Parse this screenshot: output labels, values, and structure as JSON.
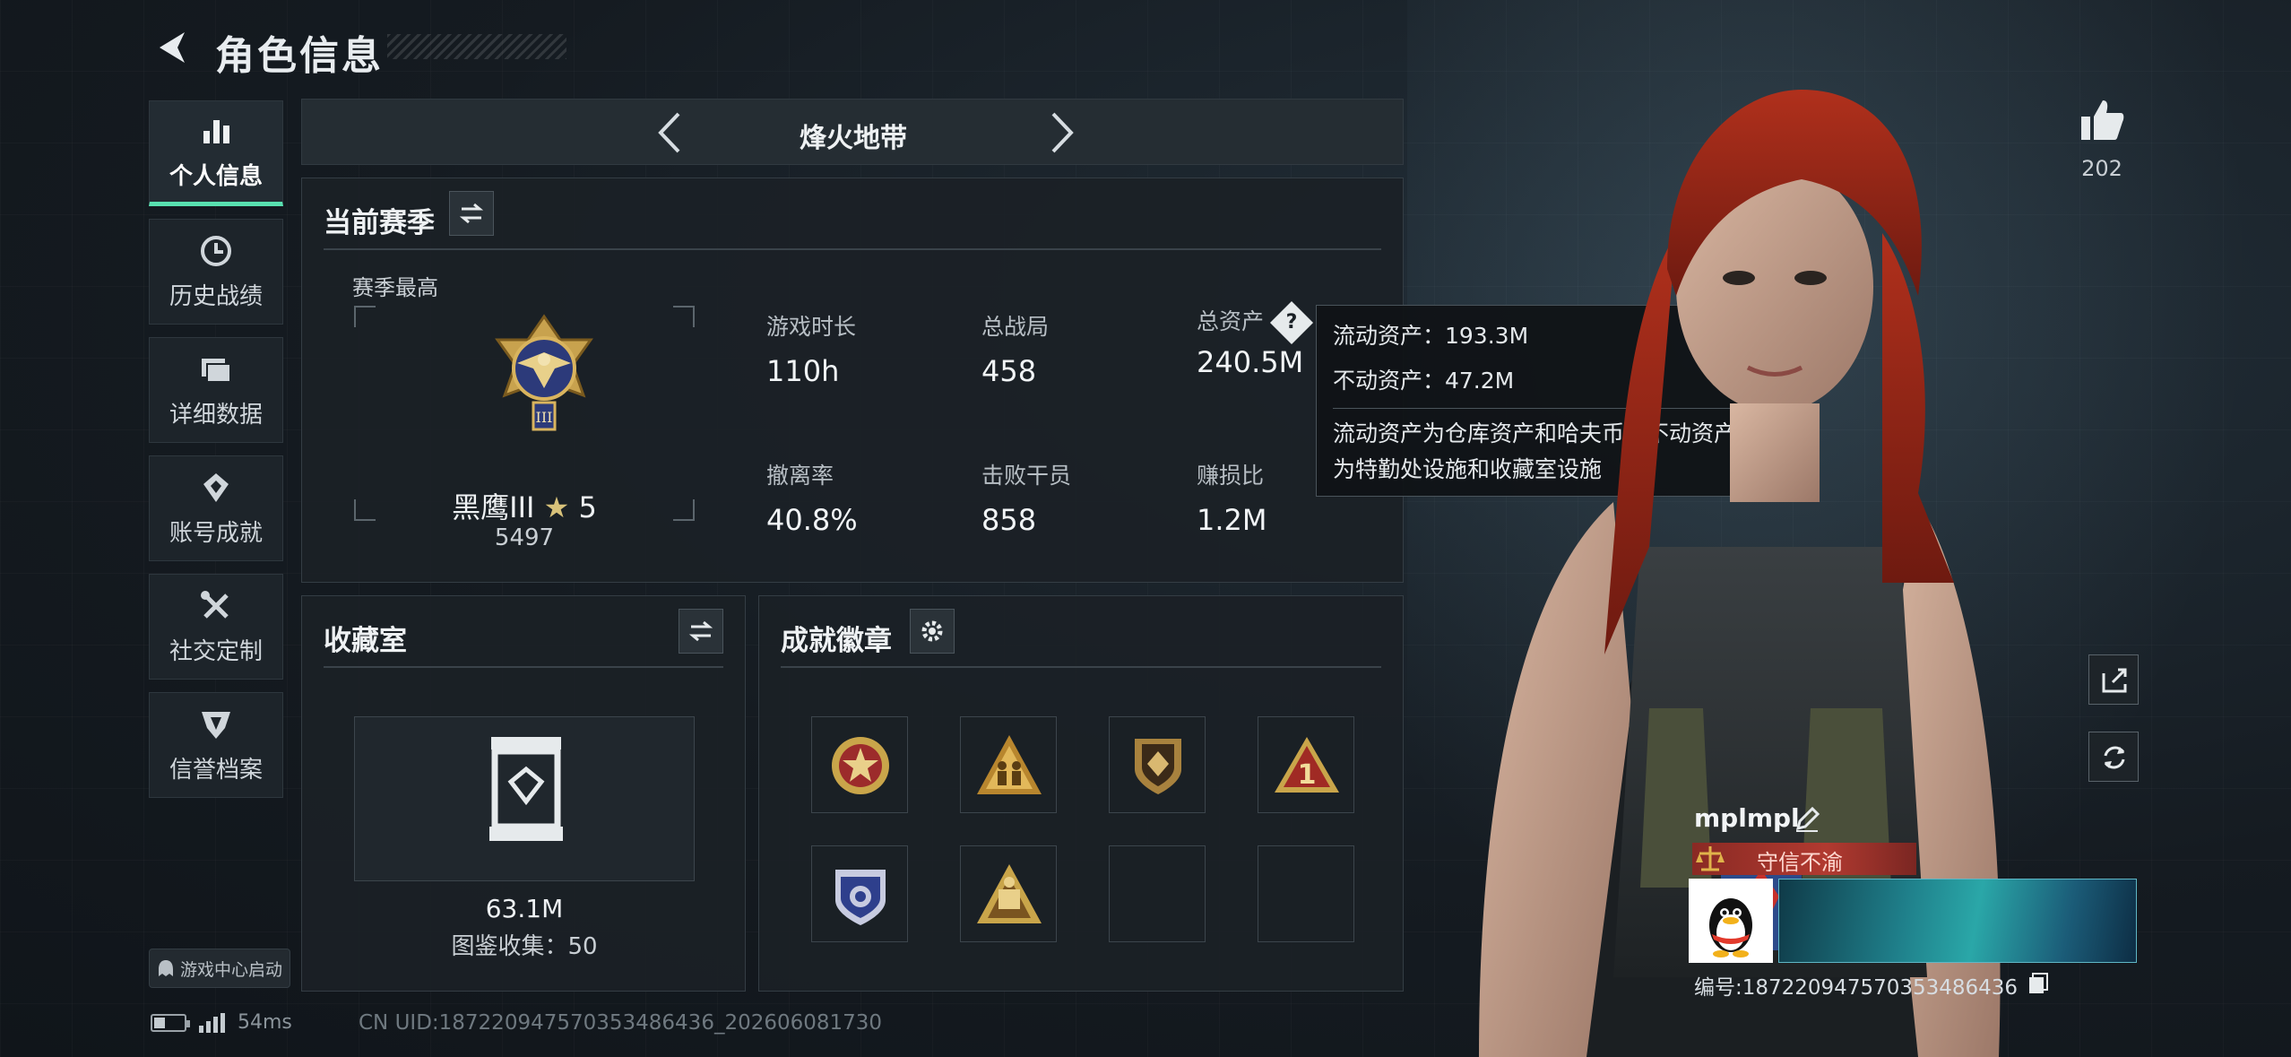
{
  "header": {
    "title": "角色信息"
  },
  "nav": {
    "items": [
      {
        "label": "个人信息",
        "icon": "bar-chart-icon",
        "active": true
      },
      {
        "label": "历史战绩",
        "icon": "clock-icon"
      },
      {
        "label": "详细数据",
        "icon": "folder-icon"
      },
      {
        "label": "账号成就",
        "icon": "achievement-icon"
      },
      {
        "label": "社交定制",
        "icon": "tools-icon"
      },
      {
        "label": "信誉档案",
        "icon": "shield-icon"
      }
    ]
  },
  "game_center": {
    "label": "游戏中心启动"
  },
  "status": {
    "ping": "54ms"
  },
  "uid_text": "CN UID:18722094757035348​6436_202606081730",
  "mode": {
    "title": "烽火地带"
  },
  "season": {
    "title": "当前赛季",
    "subtitle": "赛季最高",
    "rank_name": "黑鹰III",
    "rank_stars": "5",
    "rank_score": "5497",
    "stats": [
      {
        "label": "游戏时长",
        "value": "110h"
      },
      {
        "label": "总战局",
        "value": "458"
      },
      {
        "label": "总资产",
        "value": "240.5M"
      },
      {
        "label": "撤离率",
        "value": "40.8%"
      },
      {
        "label": "击败干员",
        "value": "858"
      },
      {
        "label": "赚损比",
        "value": "1.2M"
      }
    ]
  },
  "tooltip": {
    "liquid": "流动资产：193.3M",
    "fixed": "不动资产：47.2M",
    "description_1": "流动资产为仓库资产和哈夫币，不动资产",
    "description_2": "为特勤处设施和收藏室设施"
  },
  "collection": {
    "title": "收藏室",
    "value": "63.1M",
    "count": "图鉴收集：50"
  },
  "badges": {
    "title": "成就徽章",
    "slots": [
      {
        "icon": "star-emblem-icon",
        "filled": true
      },
      {
        "icon": "soldiers-triangle-icon",
        "filled": true
      },
      {
        "icon": "shield-diamond-icon",
        "filled": true
      },
      {
        "icon": "number-one-triangle-icon",
        "filled": true
      },
      {
        "icon": "police-shield-icon",
        "filled": true
      },
      {
        "icon": "gold-triangle-emblem-icon",
        "filled": true
      },
      {
        "icon": "",
        "filled": false
      },
      {
        "icon": "",
        "filled": false
      }
    ]
  },
  "player": {
    "likes": "202",
    "name": "mplmpl",
    "credit": "守信不渝",
    "id_text": "编号:18722094757035348​6436"
  },
  "colors": {
    "accent": "#58e0b0",
    "credit_red": "#b13a30",
    "panel_bg": "#1b2126"
  }
}
